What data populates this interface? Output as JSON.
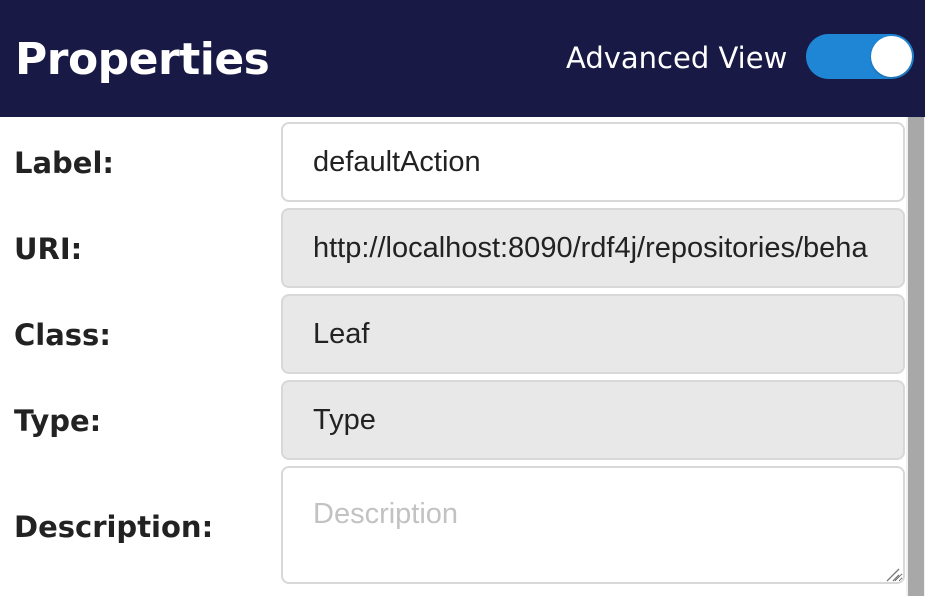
{
  "header": {
    "title": "Properties",
    "advanced_view_label": "Advanced View",
    "advanced_view_on": true
  },
  "form": {
    "label": {
      "name": "Label:",
      "value": "defaultAction"
    },
    "uri": {
      "name": "URI:",
      "value": "http://localhost:8090/rdf4j/repositories/beha"
    },
    "class": {
      "name": "Class:",
      "value": "Leaf"
    },
    "type": {
      "name": "Type:",
      "value": "Type"
    },
    "description": {
      "name": "Description:",
      "value": "",
      "placeholder": "Description"
    }
  },
  "colors": {
    "header_bg": "#181945",
    "toggle_on": "#1f86d6",
    "readonly_bg": "#e8e8e8"
  }
}
